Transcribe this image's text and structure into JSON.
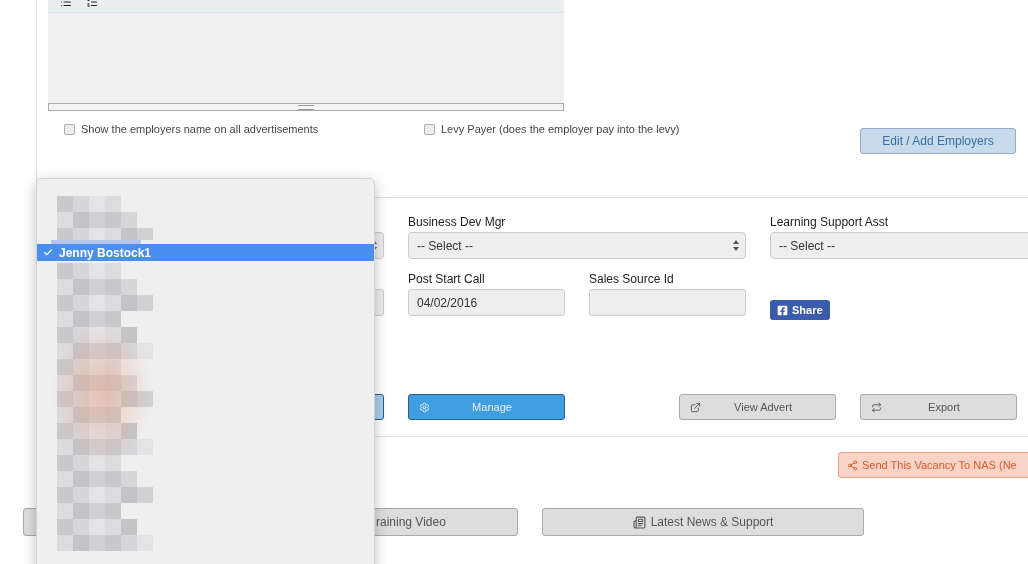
{
  "checkboxes": [
    {
      "label": "Show the employers name on all advertisements",
      "checked": false
    },
    {
      "label": "Levy Payer (does the employer pay into the levy)",
      "checked": false
    }
  ],
  "edit_employers_button": "Edit / Add Employers",
  "selects": [
    {
      "label": "Business Dev Mgr",
      "value": "-- Select --"
    },
    {
      "label": "Learning Support Asst",
      "value": "-- Select --"
    }
  ],
  "inputs": [
    {
      "label": "Post Start Call",
      "value": "04/02/2016"
    },
    {
      "label": "Sales Source Id"
    }
  ],
  "share_button": "Share",
  "actions": [
    {
      "label": "Manage",
      "kind": "primary"
    },
    {
      "label": "View Advert",
      "kind": "default"
    },
    {
      "label": "Export",
      "kind": "default"
    }
  ],
  "nas_button": "Send This Vacancy To NAS (Ne",
  "bottom_buttons": [
    {
      "label": "raining Video"
    },
    {
      "label": "Latest News & Support"
    }
  ],
  "dropdown": {
    "items": [
      {
        "label": "Jenny Bostock1",
        "selected": true
      }
    ]
  }
}
